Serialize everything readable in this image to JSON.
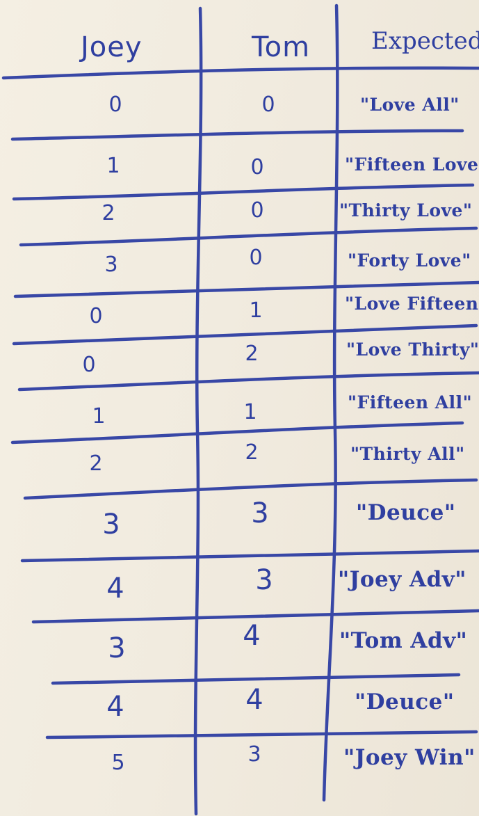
{
  "headers": {
    "joey": "Joey",
    "tom": "Tom",
    "expected": "Expected"
  },
  "rows": [
    {
      "joey": "0",
      "tom": "0",
      "expected": "\"Love All\""
    },
    {
      "joey": "1",
      "tom": "0",
      "expected": "\"Fifteen Love\""
    },
    {
      "joey": "2",
      "tom": "0",
      "expected": "\"Thirty Love\""
    },
    {
      "joey": "3",
      "tom": "0",
      "expected": "\"Forty Love\""
    },
    {
      "joey": "0",
      "tom": "1",
      "expected": "\"Love Fifteen\""
    },
    {
      "joey": "0",
      "tom": "2",
      "expected": "\"Love Thirty\""
    },
    {
      "joey": "1",
      "tom": "1",
      "expected": "\"Fifteen All\""
    },
    {
      "joey": "2",
      "tom": "2",
      "expected": "\"Thirty All\""
    },
    {
      "joey": "3",
      "tom": "3",
      "expected": "\"Deuce\""
    },
    {
      "joey": "4",
      "tom": "3",
      "expected": "\"Joey Adv\""
    },
    {
      "joey": "3",
      "tom": "4",
      "expected": "\"Tom Adv\""
    },
    {
      "joey": "4",
      "tom": "4",
      "expected": "\"Deuce\""
    },
    {
      "joey": "5",
      "tom": "3",
      "expected": "\"Joey Win\""
    }
  ],
  "ink_color": "#3847a6",
  "paper_color": "#f1ebdf"
}
